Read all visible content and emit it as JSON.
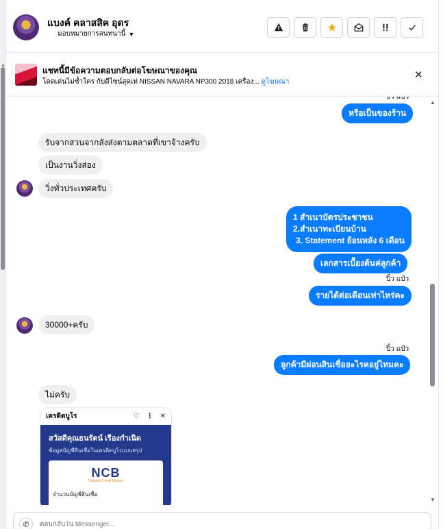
{
  "header": {
    "name": "แบงค์ คลาสสิค อุดร",
    "subtitle": "มอบหมายการสนทนานี้",
    "actions": [
      {
        "name": "report-button",
        "icon": "warning-icon",
        "glyph": "⚠"
      },
      {
        "name": "delete-button",
        "icon": "trash-icon",
        "glyph": "🗑"
      },
      {
        "name": "star-button",
        "icon": "star-icon",
        "glyph": "★"
      },
      {
        "name": "mark-unread-button",
        "icon": "envelope-open-icon",
        "glyph": "✉"
      },
      {
        "name": "follow-up-button",
        "icon": "double-exclamation-icon",
        "glyph": "!!"
      },
      {
        "name": "done-button",
        "icon": "check-icon",
        "glyph": "✓"
      }
    ]
  },
  "ad": {
    "title": "แชทนี้มีข้อความตอบกลับต่อโฆษณาของคุณ",
    "description": "โดดเด่นไม่ซ้ำใคร กับดีไซน์สุดเท่ NISSAN NAVARA NP300 2018 เครื่อง...",
    "link": "ดูโฆษณา"
  },
  "messages": {
    "top_sender": "ปิ๋ว แป๋ว",
    "m1": "หรือเป็นของร้าน",
    "m2": "รับจากสวนจากลังส่งตามตลาดที่เขาจ้างครับ",
    "m3": "เป็นงานวิ่งส่อง",
    "m4": "วิ่งทั่วประเทศครับ",
    "m5_lines": [
      "1 สำเนาบัตรประชาชน",
      "2.สำเนาทะเบียนบ้าน",
      "3. Statement ย้อนหลัง 6 เดือน"
    ],
    "m6": "เลกสารเบื้องต้นค่ลูกค้า",
    "sender_1": "ปิ๋ว แป๋ว",
    "m7": "รายได้ต่อเดือนเท่าไหร่คะ",
    "m8": "30000+ครับ",
    "sender_2": "ปิ๋ว แป๋ว",
    "m9": "ลูกค้ามีผ่อนสินเชื่ออะไรคอยู่ไหมคะ",
    "m10": "ไม่ครับ"
  },
  "card": {
    "bar_title": "เครดิตบูโร",
    "heading": "สวัสดีคุณธนรัตน์ เรืองกำเนิด",
    "subheading": "ข้อมูลบัญชีสินเชื่อในเครดิตบูโรแบบสรุป",
    "logo": "NCB",
    "logo_sub": "National Credit Bureau",
    "row_label": "จำนวนบัญชีสินเชื่อ"
  },
  "composer": {
    "placeholder": "ตอบกลับใน Messenger..."
  }
}
